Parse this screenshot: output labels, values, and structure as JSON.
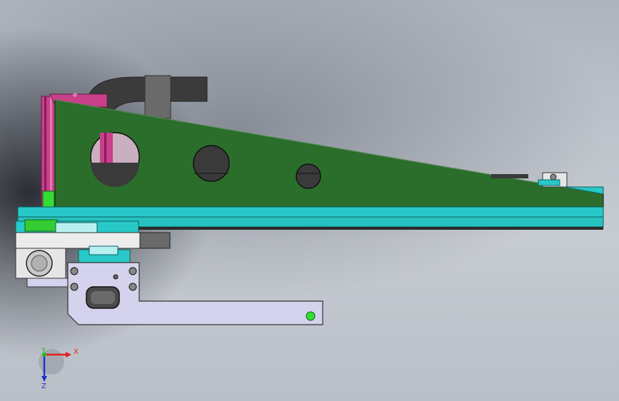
{
  "viewport": {
    "background": "#bfc4cc"
  },
  "triad": {
    "x_label": "X",
    "y_label": "Y",
    "z_label": "Z",
    "x_color": "#e02020",
    "y_color": "#20c020",
    "z_color": "#2030d0"
  },
  "colors": {
    "gusset": "#2b6e2b",
    "plate": "#28c8c8",
    "pink": "#c8408a",
    "bracket": "#d4d2ec",
    "dark_part": "#3a3a3a"
  }
}
